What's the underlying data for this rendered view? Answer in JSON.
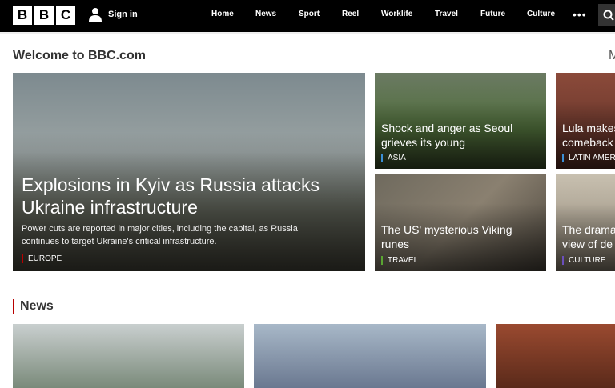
{
  "nav": {
    "logo": [
      "B",
      "B",
      "C"
    ],
    "sign_in": "Sign in",
    "links": [
      "Home",
      "News",
      "Sport",
      "Reel",
      "Worklife",
      "Travel",
      "Future",
      "Culture"
    ],
    "more": "•••"
  },
  "welcome": "Welcome to BBC.com",
  "next_section_peek": "M",
  "hero": {
    "title": "Explosions in Kyiv as Russia attacks Ukraine infrastructure",
    "summary": "Power cuts are reported in major cities, including the capital, as Russia continues to target Ukraine's critical infrastructure.",
    "tag": "EUROPE",
    "tag_color": "#b80000"
  },
  "stories": [
    {
      "title": "Shock and anger as Seoul grieves its young",
      "tag": "ASIA",
      "tag_color": "#3b8fd6"
    },
    {
      "title": "Lula makes comeback",
      "tag": "LATIN AMER",
      "tag_color": "#3b8fd6"
    },
    {
      "title": "The US' mysterious Viking runes",
      "tag": "TRAVEL",
      "tag_color": "#5aa532"
    },
    {
      "title": "The drama view of de",
      "tag": "CULTURE",
      "tag_color": "#6b4fbb"
    }
  ],
  "news": {
    "heading": "News"
  }
}
